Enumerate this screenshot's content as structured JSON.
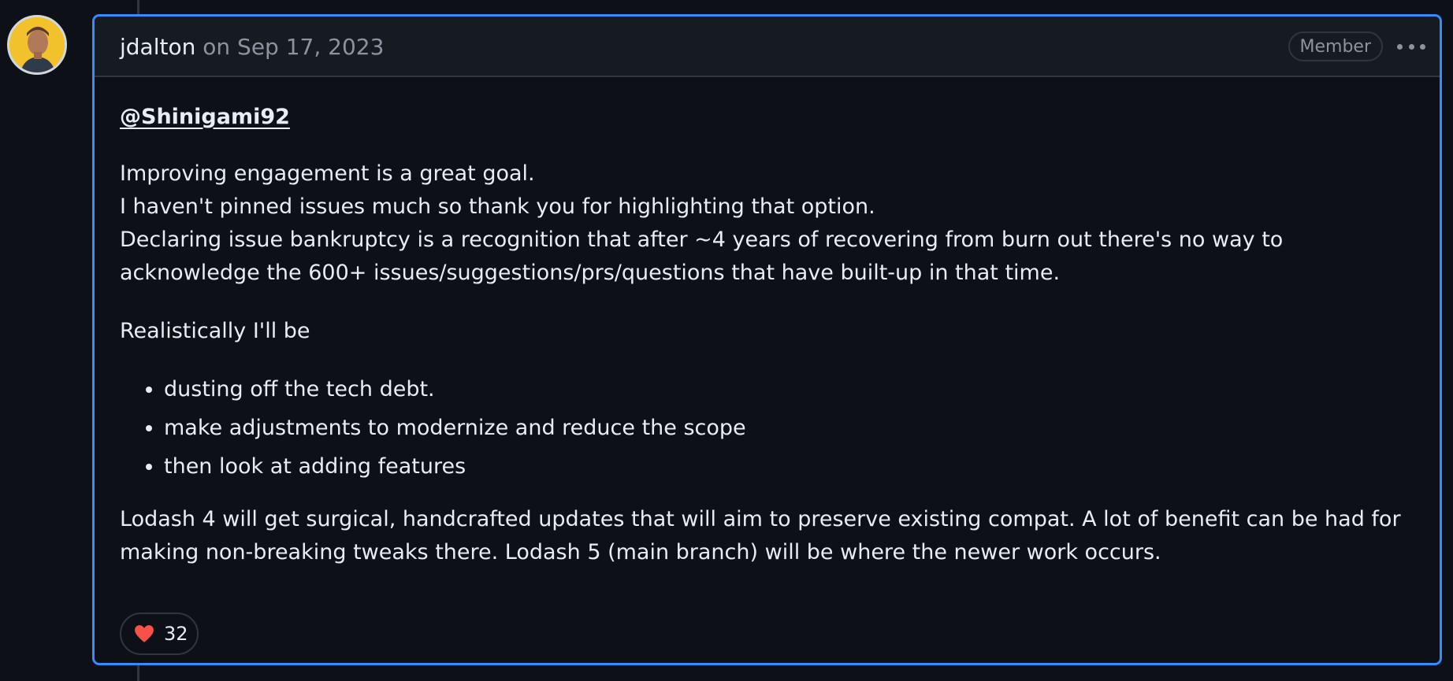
{
  "comment": {
    "author": "jdalton",
    "date": "on Sep 17, 2023",
    "badge": "Member",
    "mention": "@Shinigami92",
    "paragraph1_lines": [
      "Improving engagement is a great goal.",
      "I haven't pinned issues much so thank you for highlighting that option.",
      "Declaring issue bankruptcy is a recognition that after ~4 years of recovering from burn out there's no way to acknowledge the 600+ issues/suggestions/prs/questions that have built-up in that time."
    ],
    "paragraph2": "Realistically I'll be",
    "bullets": [
      "dusting off the tech debt.",
      "make adjustments to modernize and reduce the scope",
      "then look at adding features"
    ],
    "paragraph3": "Lodash 4 will get surgical, handcrafted updates that will aim to preserve existing compat. A lot of benefit can be had for making non-breaking tweaks there. Lodash 5 (main branch) will be where the newer work occurs.",
    "reaction": {
      "icon": "heart-icon",
      "count": "32"
    }
  },
  "colors": {
    "background": "#0d1117",
    "header": "#161b22",
    "border_focus": "#388bfd",
    "muted": "#8b949e",
    "text": "#e6edf3",
    "heart": "#f85149"
  }
}
